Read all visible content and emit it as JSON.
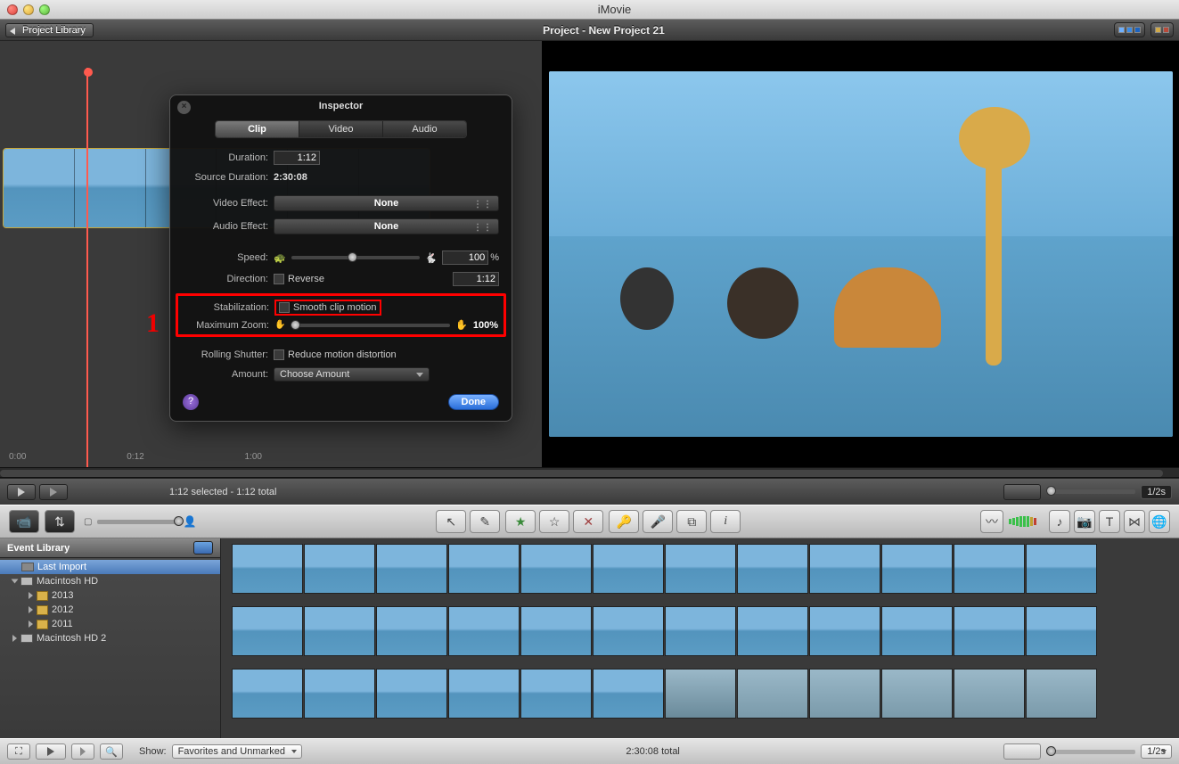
{
  "titlebar": {
    "app": "iMovie"
  },
  "projbar": {
    "back": "Project Library",
    "name": "Project - New Project 21"
  },
  "inspector": {
    "title": "Inspector",
    "tabs": {
      "clip": "Clip",
      "video": "Video",
      "audio": "Audio"
    },
    "duration_label": "Duration:",
    "duration_value": "1:12",
    "source_label": "Source Duration:",
    "source_value": "2:30:08",
    "video_effect_label": "Video Effect:",
    "video_effect_value": "None",
    "audio_effect_label": "Audio Effect:",
    "audio_effect_value": "None",
    "speed_label": "Speed:",
    "speed_pct": "100",
    "speed_unit": "%",
    "speed_time": "1:12",
    "direction_label": "Direction:",
    "direction_value": "Reverse",
    "stab_label": "Stabilization:",
    "stab_value": "Smooth clip motion",
    "zoom_label": "Maximum Zoom:",
    "zoom_value": "100%",
    "rolling_label": "Rolling Shutter:",
    "rolling_value": "Reduce motion distortion",
    "amount_label": "Amount:",
    "amount_value": "Choose Amount",
    "done": "Done"
  },
  "annot": {
    "one": "1"
  },
  "timeline": {
    "tick0": "0:00",
    "tick1": "0:12",
    "tick2": "1:00",
    "selected": "1:12 selected - 1:12 total",
    "zoom": "1/2s"
  },
  "evt": {
    "header": "Event Library",
    "last_import": "Last Import",
    "mac_hd": "Macintosh HD",
    "y2013": "2013",
    "y2012": "2012",
    "y2011": "2011",
    "mac_hd2": "Macintosh HD 2"
  },
  "bottombar": {
    "show": "Show:",
    "filter": "Favorites and Unmarked",
    "total": "2:30:08 total",
    "zoom": "1/2s"
  }
}
